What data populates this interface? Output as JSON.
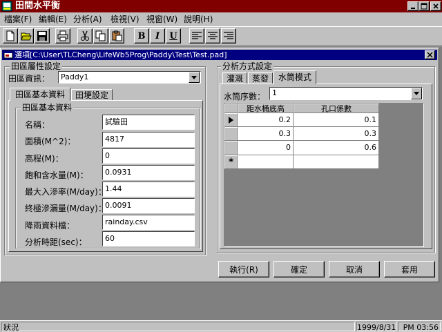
{
  "app": {
    "title": "田間水平衡"
  },
  "menu": [
    "檔案(F)",
    "編輯(E)",
    "分析(A)",
    "檢視(V)",
    "視窗(W)",
    "說明(H)"
  ],
  "toolbar": {
    "icons": [
      "new-file-icon",
      "open-folder-icon",
      "save-icon",
      "print-icon",
      "cut-icon",
      "copy-icon",
      "paste-icon",
      "bold-icon",
      "italic-icon",
      "underline-icon",
      "align-left-icon",
      "align-center-icon",
      "align-right-icon"
    ],
    "bold": "B",
    "italic": "I",
    "underline": "U"
  },
  "dialog": {
    "title": "選項[C:\\User\\TLCheng\\LifeWb5Prog\\Paddy\\Test\\Test.pad]",
    "field_settings": {
      "group_label": "田區屬性設定",
      "field_info_label": "田區資訊：",
      "field_info_value": "Paddy1",
      "tabs": [
        "田區基本資料",
        "田埂設定"
      ],
      "basic_group_label": "田區基本資料",
      "rows": [
        {
          "label": "名稱：",
          "value": "試驗田"
        },
        {
          "label": "面積(M^2)：",
          "value": "4817"
        },
        {
          "label": "高程(M)：",
          "value": "0"
        },
        {
          "label": "飽和含水量(M)：",
          "value": "0.0931"
        },
        {
          "label": "最大入滲率(M/day)：",
          "value": "1.44"
        },
        {
          "label": "終極滲漏量(M/day)：",
          "value": "0.0091"
        },
        {
          "label": "降雨資料檔：",
          "value": "rainday.csv"
        },
        {
          "label": "分析時距(sec)：",
          "value": "60"
        }
      ]
    },
    "analysis": {
      "group_label": "分析方式設定",
      "tabs": [
        "灌溉",
        "蒸發",
        "水筒模式"
      ],
      "tank_seq_label": "水筒序數：",
      "tank_seq_value": "1",
      "grid_headers": [
        "距水桶底高",
        "孔口係數"
      ],
      "grid_rows": [
        [
          "0.2",
          "0.1"
        ],
        [
          "0.3",
          "0.3"
        ],
        [
          "0",
          "0.6"
        ]
      ],
      "new_row_marker": "*"
    },
    "buttons": {
      "run": "執行(R)",
      "ok": "確定",
      "cancel": "取消",
      "apply": "套用"
    }
  },
  "status": {
    "text": "狀況",
    "date": "1999/8/31",
    "time": "PM 03:56"
  }
}
